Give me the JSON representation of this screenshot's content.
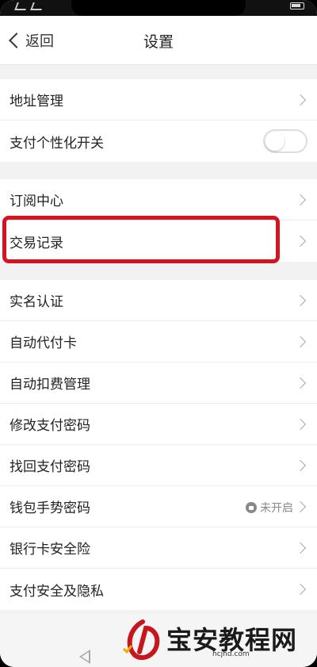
{
  "header": {
    "back_label": "返回",
    "title": "设置"
  },
  "groups": [
    {
      "items": [
        {
          "label": "地址管理",
          "control": "chevron"
        },
        {
          "label": "支付个性化开关",
          "control": "toggle",
          "toggle_on": false
        }
      ]
    },
    {
      "items": [
        {
          "label": "订阅中心",
          "control": "chevron"
        },
        {
          "label": "交易记录",
          "control": "chevron",
          "highlighted": true
        }
      ]
    },
    {
      "items": [
        {
          "label": "实名认证",
          "control": "chevron"
        },
        {
          "label": "自动代付卡",
          "control": "chevron"
        },
        {
          "label": "自动扣费管理",
          "control": "chevron"
        },
        {
          "label": "修改支付密码",
          "control": "chevron"
        },
        {
          "label": "找回支付密码",
          "control": "chevron"
        },
        {
          "label": "钱包手势密码",
          "control": "chevron",
          "status": "未开启"
        },
        {
          "label": "银行卡安全险",
          "control": "chevron"
        },
        {
          "label": "支付安全及隐私",
          "control": "chevron"
        }
      ]
    }
  ],
  "watermark": {
    "text": "宝安教程网",
    "domain": "hcjhd.com"
  },
  "colors": {
    "highlight": "#d4141e",
    "background": "#f2f2f2"
  }
}
